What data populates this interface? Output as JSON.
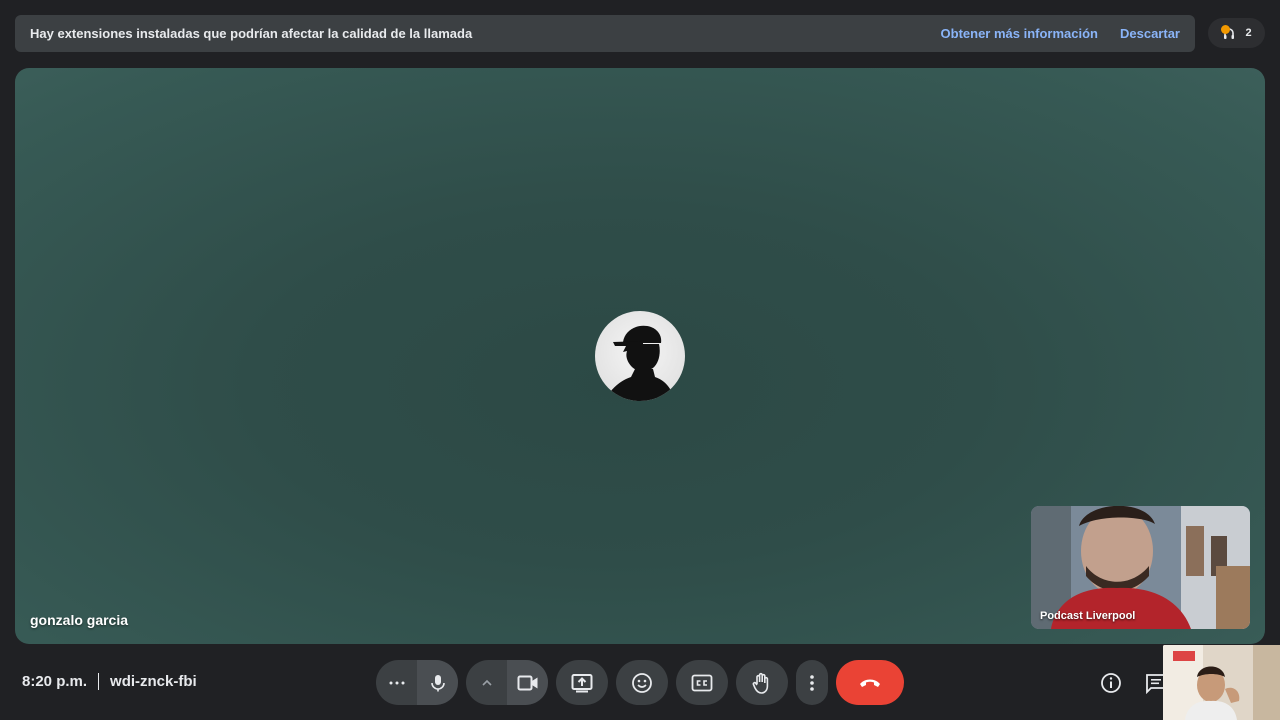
{
  "banner": {
    "message": "Hay extensiones instaladas que podrían afectar la calidad de la llamada",
    "learn_more": "Obtener más información",
    "dismiss": "Descartar"
  },
  "participants_pill": {
    "count": "2",
    "icon": "headset-icon",
    "dot_color": "#f29900"
  },
  "stage": {
    "participant_name": "gonzalo garcia",
    "avatar_icon": "person-cap-silhouette-icon"
  },
  "self_view": {
    "name": "Podcast Liverpool"
  },
  "bottom": {
    "time": "8:20 p.m.",
    "meeting_code": "wdi-znck-fbi",
    "controls": [
      "more-mic-options-icon",
      "microphone-icon",
      "chevron-up-icon",
      "video-camera-icon",
      "present-screen-icon",
      "emoji-icon",
      "captions-icon",
      "raise-hand-icon",
      "more-options-icon",
      "hang-up-icon"
    ],
    "right_icons": [
      "info-icon",
      "chat-icon"
    ]
  },
  "colors": {
    "background": "#202124",
    "banner": "#3c4043",
    "link": "#8ab4f8",
    "stage": "#2f4d49",
    "control": "#3c4043",
    "hangup": "#ea4335"
  }
}
